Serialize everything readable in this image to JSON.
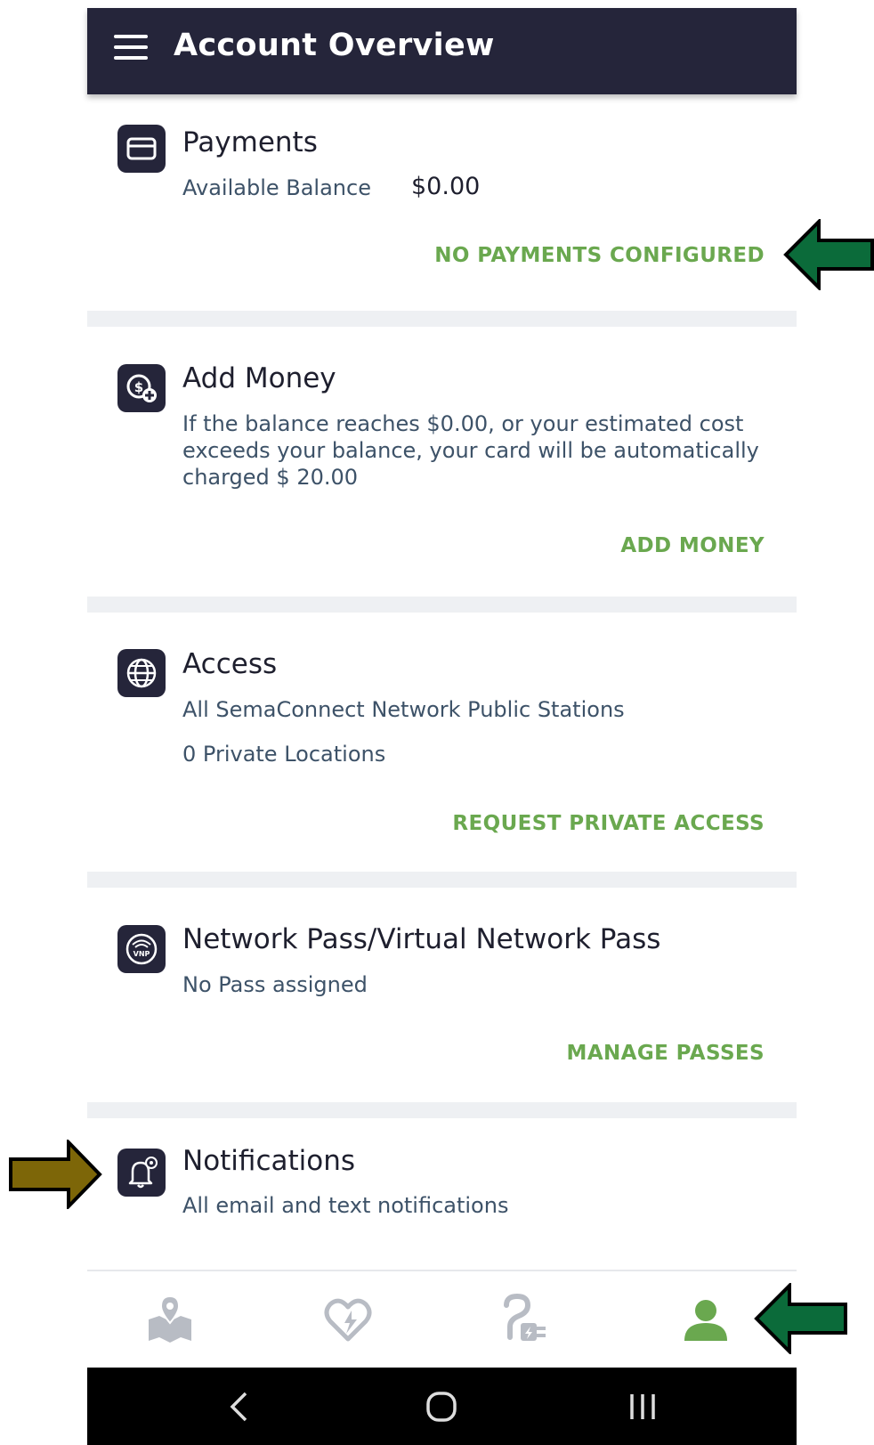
{
  "header": {
    "title": "Account Overview"
  },
  "payments": {
    "title": "Payments",
    "balance_label": "Available Balance",
    "balance_value": "$0.00",
    "action": "NO PAYMENTS CONFIGURED"
  },
  "add_money": {
    "title": "Add Money",
    "description_line1": "If the balance reaches $0.00, or your estimated cost",
    "description_line2": "exceeds your balance, your card will be automatically",
    "description_line3": "charged $ 20.00",
    "action": "ADD MONEY"
  },
  "access": {
    "title": "Access",
    "line1": "All SemaConnect Network Public Stations",
    "line2": "0 Private Locations",
    "action": "REQUEST PRIVATE ACCESS"
  },
  "network_pass": {
    "title": "Network Pass/Virtual Network Pass",
    "line1": "No Pass assigned",
    "action": "MANAGE PASSES",
    "icon_text": "VNP"
  },
  "notifications": {
    "title": "Notifications",
    "line1": "All email and text notifications"
  },
  "bottom_nav": {
    "items": [
      "map-icon",
      "favorites-icon",
      "charging-icon",
      "account-icon"
    ],
    "active": "account-icon",
    "active_color": "#6aa84f",
    "inactive_color": "#b8bcc4"
  },
  "colors": {
    "appbar": "#25253a",
    "action_green": "#6aa84f",
    "arrow_green": "#0b6b3a",
    "arrow_gold": "#7d6608"
  }
}
